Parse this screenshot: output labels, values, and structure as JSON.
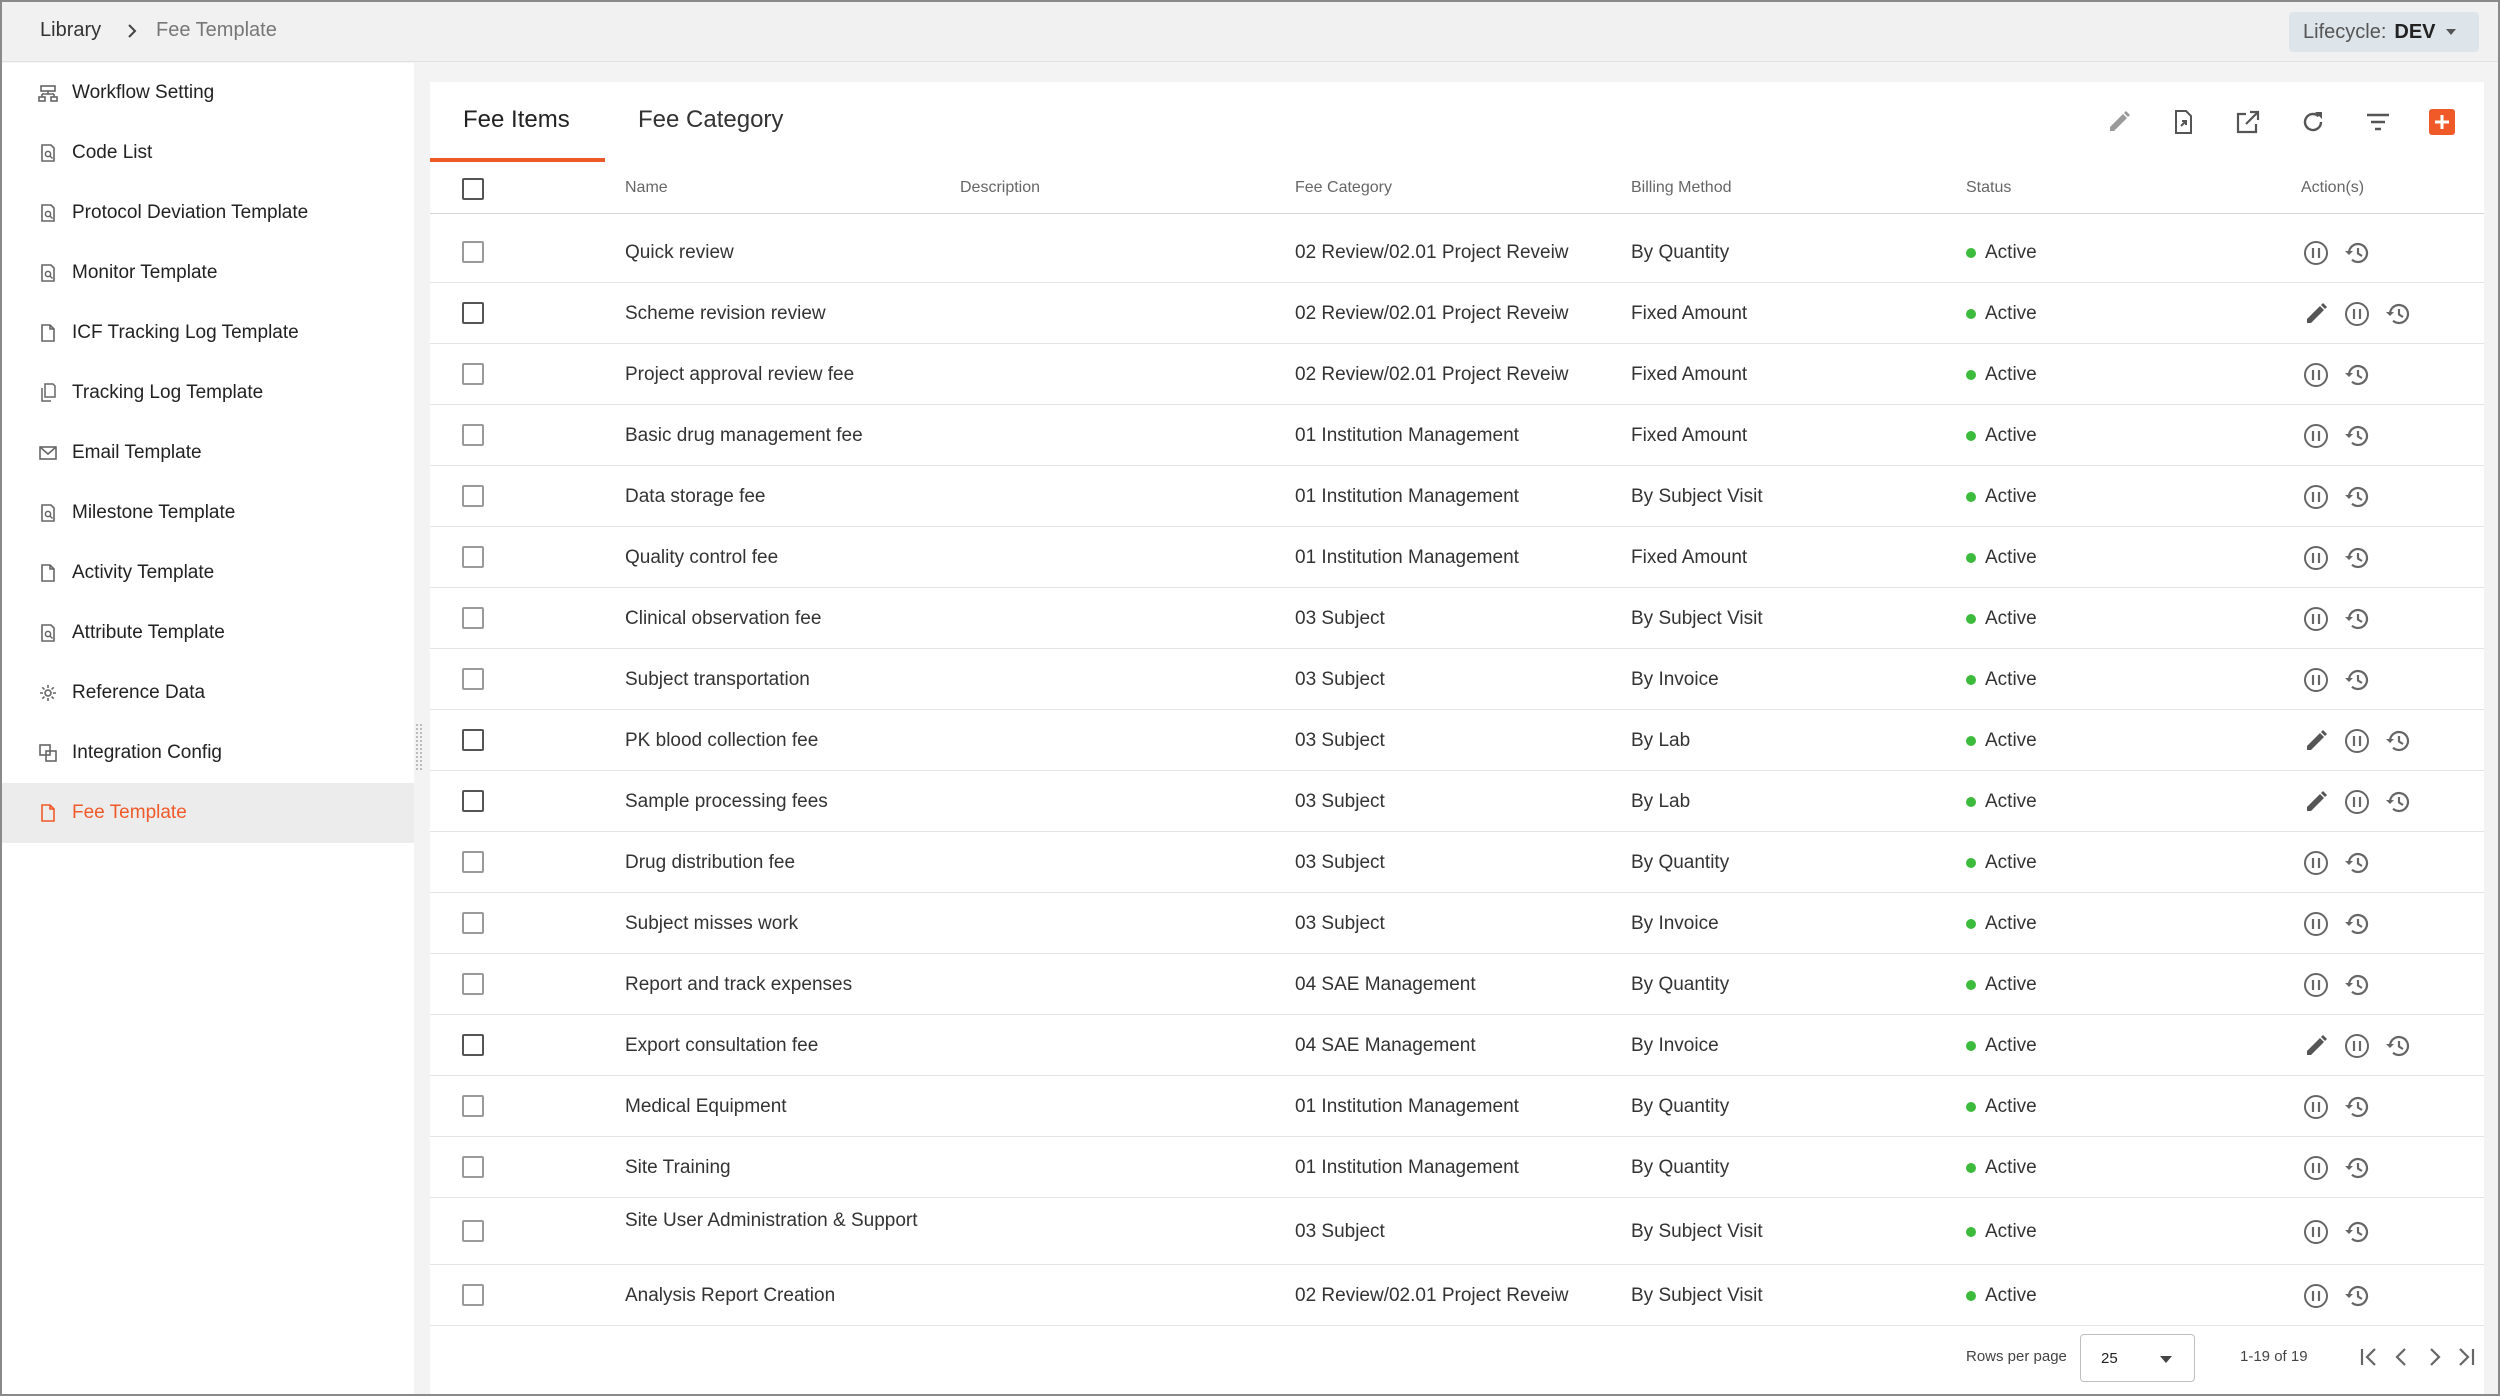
{
  "breadcrumb": {
    "root": "Library",
    "current": "Fee Template"
  },
  "lifecycle": {
    "label": "Lifecycle:",
    "value": "DEV"
  },
  "sidebar": {
    "items": [
      {
        "label": "Workflow Setting",
        "icon": "workflow-icon"
      },
      {
        "label": "Code List",
        "icon": "document-search-icon"
      },
      {
        "label": "Protocol Deviation Template",
        "icon": "document-search-icon"
      },
      {
        "label": "Monitor Template",
        "icon": "document-search-icon"
      },
      {
        "label": "ICF Tracking Log Template",
        "icon": "document-icon"
      },
      {
        "label": "Tracking Log Template",
        "icon": "copy-document-icon"
      },
      {
        "label": "Email Template",
        "icon": "mail-icon"
      },
      {
        "label": "Milestone Template",
        "icon": "document-search-icon"
      },
      {
        "label": "Activity Template",
        "icon": "document-icon"
      },
      {
        "label": "Attribute Template",
        "icon": "document-search-icon"
      },
      {
        "label": "Reference Data",
        "icon": "gear-icon"
      },
      {
        "label": "Integration Config",
        "icon": "integration-icon"
      },
      {
        "label": "Fee Template",
        "icon": "document-icon",
        "active": true
      }
    ]
  },
  "tabs": [
    {
      "label": "Fee Items",
      "active": true
    },
    {
      "label": "Fee Category",
      "active": false
    }
  ],
  "toolbar": [
    "edit-icon",
    "export-file-icon",
    "open-external-icon",
    "refresh-icon",
    "filter-icon",
    "add-icon"
  ],
  "colors": {
    "accent": "#f05a28",
    "status_active": "#3dbb3d",
    "lifecycle_bg": "#dde4ea"
  },
  "table": {
    "headers": {
      "name": "Name",
      "description": "Description",
      "category": "Fee Category",
      "billing": "Billing Method",
      "status": "Status",
      "actions": "Action(s)"
    },
    "rows": [
      {
        "name": "Quick review",
        "description": "",
        "category": "02 Review/02.01 Project Reveiw",
        "billing": "By Quantity",
        "status": "Active",
        "editable": false
      },
      {
        "name": "Scheme revision review",
        "description": "",
        "category": "02 Review/02.01 Project Reveiw",
        "billing": "Fixed Amount",
        "status": "Active",
        "editable": true
      },
      {
        "name": "Project approval review fee",
        "description": "",
        "category": "02 Review/02.01 Project Reveiw",
        "billing": "Fixed Amount",
        "status": "Active",
        "editable": false
      },
      {
        "name": "Basic drug management fee",
        "description": "",
        "category": "01 Institution Management",
        "billing": "Fixed Amount",
        "status": "Active",
        "editable": false
      },
      {
        "name": "Data storage fee",
        "description": "",
        "category": "01 Institution Management",
        "billing": "By Subject Visit",
        "status": "Active",
        "editable": false
      },
      {
        "name": "Quality control fee",
        "description": "",
        "category": "01 Institution Management",
        "billing": "Fixed Amount",
        "status": "Active",
        "editable": false
      },
      {
        "name": "Clinical observation fee",
        "description": "",
        "category": "03 Subject",
        "billing": "By Subject Visit",
        "status": "Active",
        "editable": false
      },
      {
        "name": "Subject transportation",
        "description": "",
        "category": "03 Subject",
        "billing": "By Invoice",
        "status": "Active",
        "editable": false
      },
      {
        "name": "PK blood collection fee",
        "description": "",
        "category": "03 Subject",
        "billing": "By Lab",
        "status": "Active",
        "editable": true
      },
      {
        "name": "Sample processing fees",
        "description": "",
        "category": "03 Subject",
        "billing": "By Lab",
        "status": "Active",
        "editable": true
      },
      {
        "name": "Drug distribution fee",
        "description": "",
        "category": "03 Subject",
        "billing": "By Quantity",
        "status": "Active",
        "editable": false
      },
      {
        "name": "Subject misses work",
        "description": "",
        "category": "03 Subject",
        "billing": "By Invoice",
        "status": "Active",
        "editable": false
      },
      {
        "name": "Report and track expenses",
        "description": "",
        "category": "04 SAE Management",
        "billing": "By Quantity",
        "status": "Active",
        "editable": false
      },
      {
        "name": "Export consultation fee",
        "description": "",
        "category": "04 SAE Management",
        "billing": "By Invoice",
        "status": "Active",
        "editable": true
      },
      {
        "name": "Medical Equipment",
        "description": "",
        "category": "01 Institution Management",
        "billing": "By Quantity",
        "status": "Active",
        "editable": false
      },
      {
        "name": "Site Training",
        "description": "",
        "category": "01 Institution Management",
        "billing": "By Quantity",
        "status": "Active",
        "editable": false
      },
      {
        "name": "Site User Administration & Support",
        "description": "",
        "category": "03 Subject",
        "billing": "By Subject Visit",
        "status": "Active",
        "editable": false
      },
      {
        "name": "Analysis Report Creation",
        "description": "",
        "category": "02 Review/02.01 Project Reveiw",
        "billing": "By Subject Visit",
        "status": "Active",
        "editable": false
      }
    ]
  },
  "pagination": {
    "rows_per_page_label": "Rows per page",
    "rows_per_page": "25",
    "range": "1-19 of 19"
  }
}
